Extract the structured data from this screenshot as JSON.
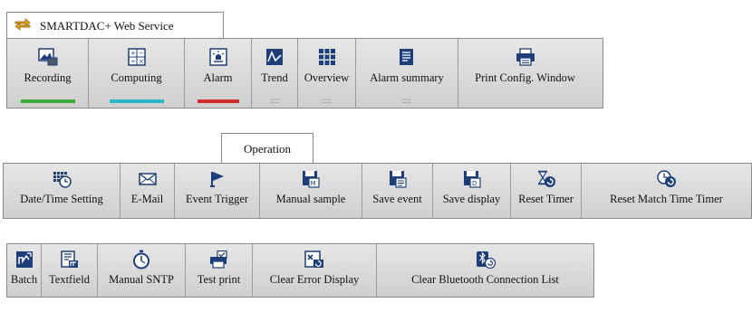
{
  "app": {
    "title": "SMARTDAC+ Web Service"
  },
  "main_toolbar": {
    "recording": {
      "label": "Recording",
      "bar_color": "#3cad3c"
    },
    "computing": {
      "label": "Computing",
      "bar_color": "#2ab6c9"
    },
    "alarm": {
      "label": "Alarm",
      "bar_color": "#d12a2a"
    },
    "trend": {
      "label": "Trend",
      "dots": "::::"
    },
    "overview": {
      "label": "Overview",
      "dots": "::::"
    },
    "alarm_summary": {
      "label": "Alarm summary",
      "dots": "::::"
    },
    "print_config": {
      "label": "Print Config. Window"
    }
  },
  "operation_tab": {
    "label": "Operation"
  },
  "operation_toolbar": {
    "datetime": {
      "label": "Date/Time Setting"
    },
    "email": {
      "label": "E-Mail"
    },
    "event_trigger": {
      "label": "Event Trigger"
    },
    "manual_sample": {
      "label": "Manual sample"
    },
    "save_event": {
      "label": "Save event"
    },
    "save_display": {
      "label": "Save display"
    },
    "reset_timer": {
      "label": "Reset Timer"
    },
    "reset_match_time_timer": {
      "label": "Reset Match Time Timer"
    }
  },
  "third_toolbar": {
    "batch": {
      "label": "Batch"
    },
    "textfield": {
      "label": "Textfield"
    },
    "manual_sntp": {
      "label": "Manual SNTP"
    },
    "test_print": {
      "label": "Test print"
    },
    "clear_error_display": {
      "label": "Clear Error Display"
    },
    "clear_bluetooth": {
      "label": "Clear Bluetooth Connection List"
    }
  },
  "icon_colors": {
    "navy": "#1c3f7a",
    "accent_orange": "#e8a317"
  }
}
